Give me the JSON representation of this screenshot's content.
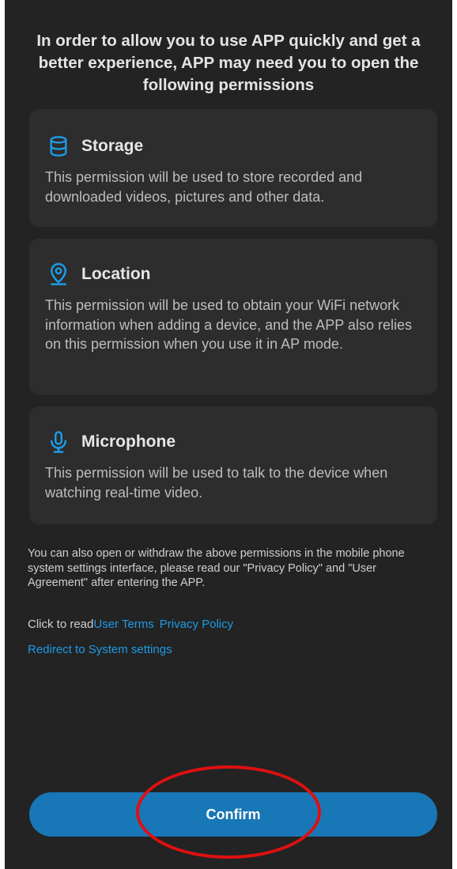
{
  "header": {
    "title": "In order to allow you to use APP quickly and get a better experience, APP may need you to open the following permissions"
  },
  "permissions": [
    {
      "icon": "database-icon",
      "title": "Storage",
      "description": "This permission will be used to store recorded and downloaded videos, pictures and other data."
    },
    {
      "icon": "location-pin-icon",
      "title": "Location",
      "description": "This permission will be used to obtain your WiFi network information when adding a device, and the APP also relies on this permission when you use it in AP mode."
    },
    {
      "icon": "microphone-icon",
      "title": "Microphone",
      "description": "This permission will be used to talk to the device when watching real-time video."
    }
  ],
  "note": "You can also open or withdraw the above permissions in the mobile phone system settings interface, please read our \"Privacy Policy\" and \"User Agreement\" after entering the APP.",
  "links": {
    "prefix": "Click to read",
    "user_terms": "User Terms",
    "privacy_policy": "Privacy Policy",
    "redirect": "Redirect to System settings"
  },
  "confirm_label": "Confirm",
  "colors": {
    "background": "#232323",
    "card": "#2d2d2d",
    "accent": "#1e9be6",
    "button": "#1877b6",
    "annotation": "#e01010"
  }
}
